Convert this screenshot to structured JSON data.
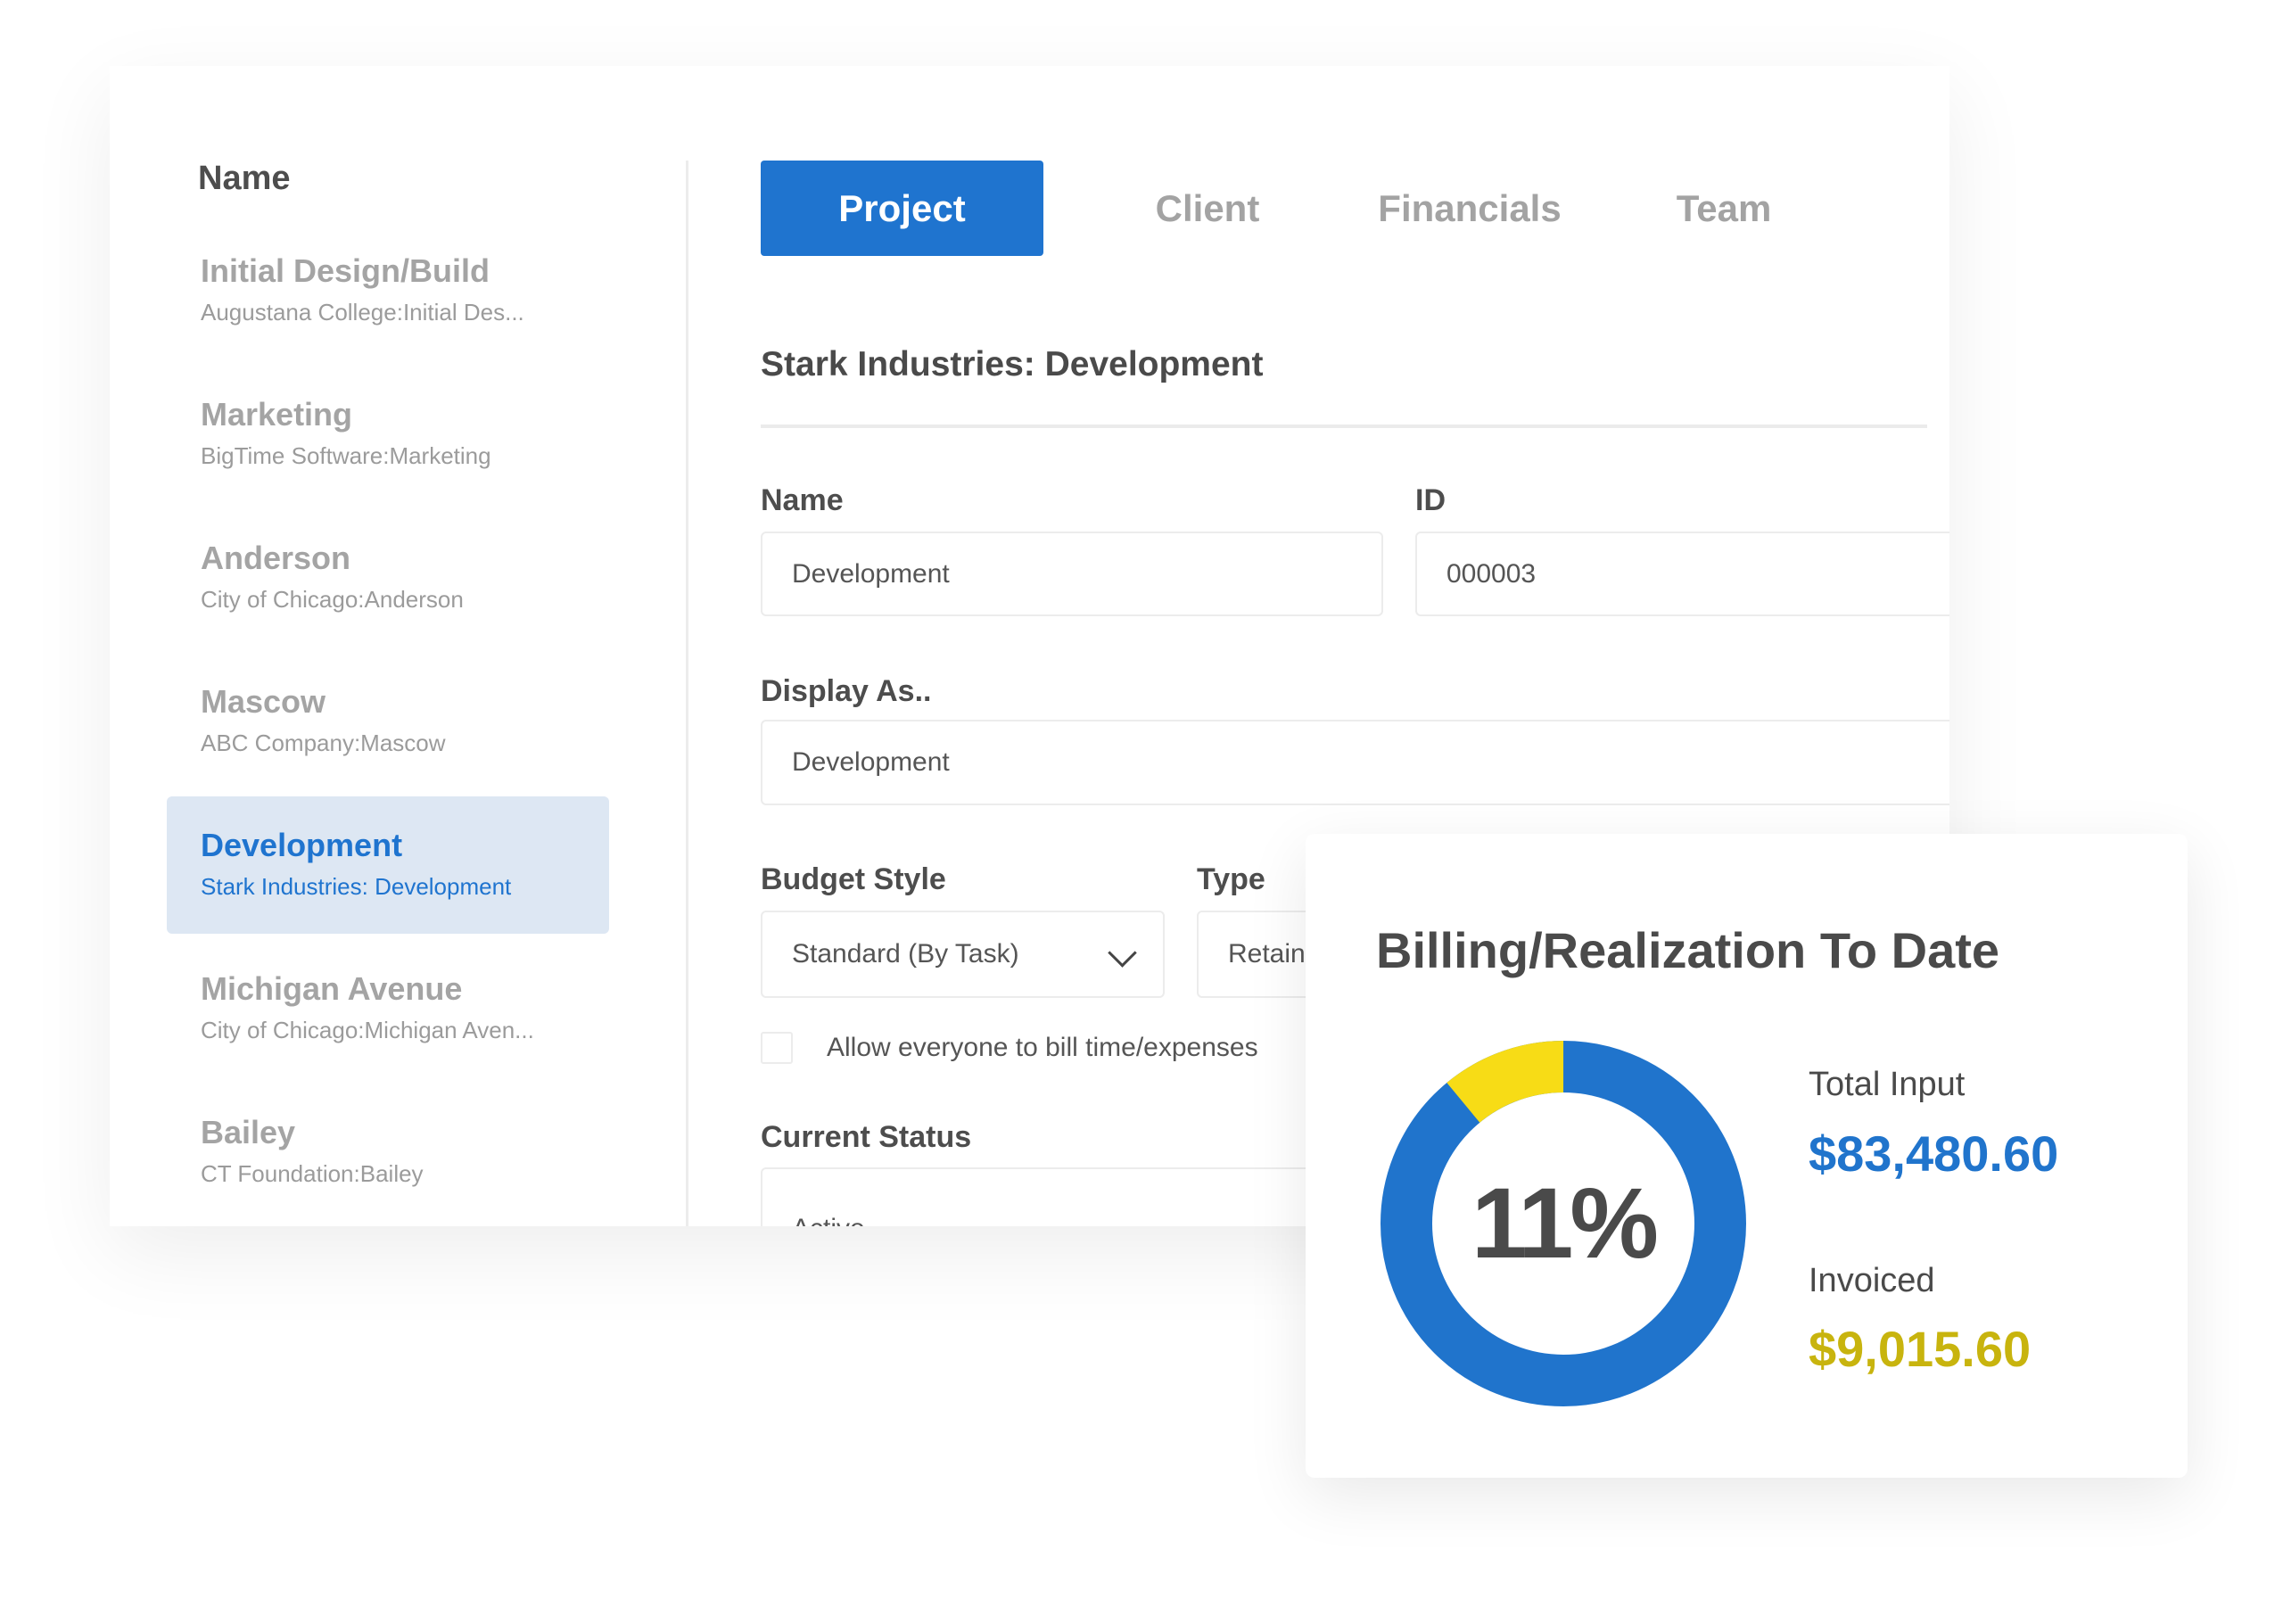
{
  "sidebar": {
    "heading": "Name",
    "items": [
      {
        "title": "Initial Design/Build",
        "subtitle": "Augustana College:Initial Des..."
      },
      {
        "title": "Marketing",
        "subtitle": "BigTime Software:Marketing"
      },
      {
        "title": "Anderson",
        "subtitle": "City of Chicago:Anderson"
      },
      {
        "title": "Mascow",
        "subtitle": "ABC Company:Mascow"
      },
      {
        "title": "Development",
        "subtitle": "Stark Industries: Development",
        "selected": true
      },
      {
        "title": "Michigan Avenue",
        "subtitle": "City of Chicago:Michigan Aven..."
      },
      {
        "title": "Bailey",
        "subtitle": "CT Foundation:Bailey"
      }
    ]
  },
  "tabs": [
    {
      "label": "Project",
      "active": true
    },
    {
      "label": "Client"
    },
    {
      "label": "Financials"
    },
    {
      "label": "Team"
    }
  ],
  "form": {
    "heading": "Stark Industries: Development",
    "name_label": "Name",
    "name_value": "Development",
    "id_label": "ID",
    "id_value": "000003",
    "display_label": "Display As..",
    "display_value": "Development",
    "budget_label": "Budget Style",
    "budget_value": "Standard (By Task)",
    "type_label": "Type",
    "type_value": "Retainer",
    "allow_label": "Allow everyone to bill time/expenses",
    "allow_checked": false,
    "status_label": "Current Status",
    "status_value": "Active"
  },
  "billing": {
    "title": "Billing/Realization To Date",
    "percent_label": "11%",
    "total_input_label": "Total Input",
    "total_input_value": "$83,480.60",
    "invoiced_label": "Invoiced",
    "invoiced_value": "$9,015.60",
    "invoiced_fraction": 0.11,
    "colors": {
      "total": "#2074cc",
      "invoiced": "#f7dc16",
      "invoiced_text": "#c8b40e"
    }
  }
}
